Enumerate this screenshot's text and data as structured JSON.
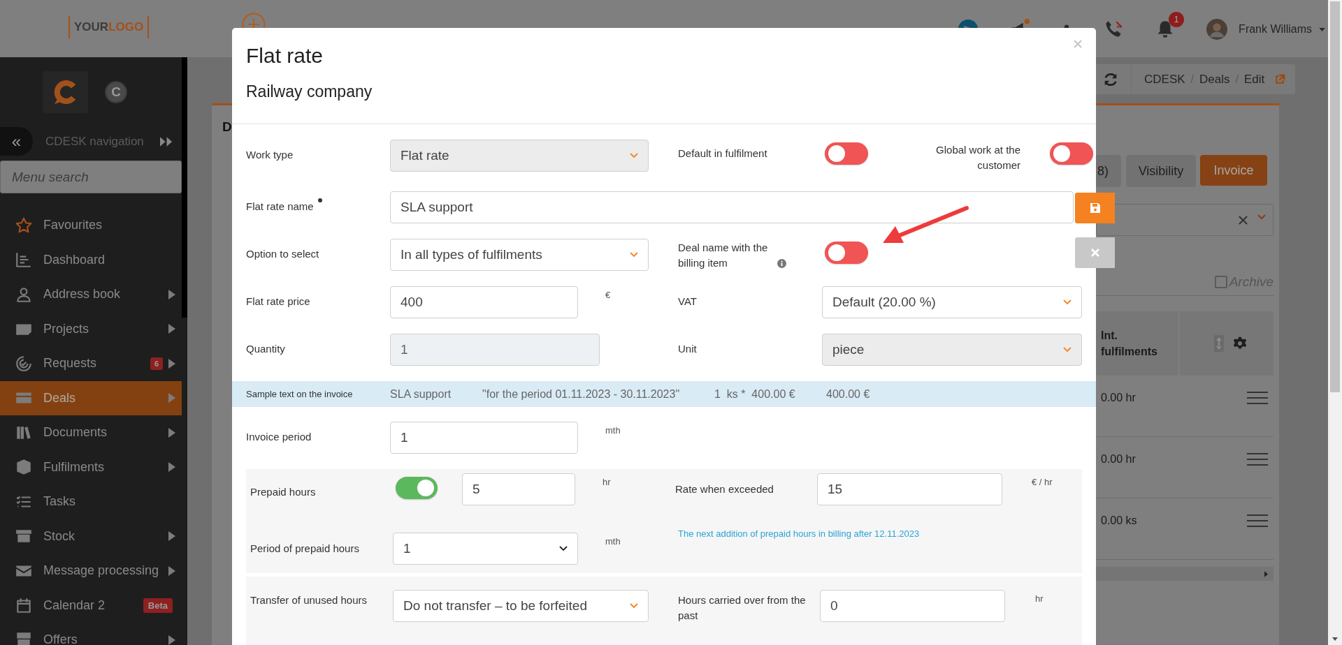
{
  "top_bar": {
    "logo": {
      "first": "YOUR",
      "second": "LOGO"
    },
    "notification_count": "1",
    "user_name": "Frank Williams"
  },
  "sidebar": {
    "initial": "C",
    "collapse": "«",
    "navigation_title": "CDESK navigation",
    "search": {
      "placeholder": "Menu search"
    },
    "items": [
      {
        "label": "Favourites",
        "submenu": false,
        "selected": false
      },
      {
        "label": "Dashboard",
        "submenu": false,
        "selected": false
      },
      {
        "label": "Address book",
        "submenu": true,
        "selected": false
      },
      {
        "label": "Projects",
        "submenu": true,
        "selected": false
      },
      {
        "label": "Requests",
        "submenu": true,
        "selected": false,
        "badge": "6"
      },
      {
        "label": "Deals",
        "submenu": true,
        "selected": true
      },
      {
        "label": "Documents",
        "submenu": true,
        "selected": false
      },
      {
        "label": "Fulfilments",
        "submenu": true,
        "selected": false
      },
      {
        "label": "Tasks",
        "submenu": false,
        "selected": false
      },
      {
        "label": "Stock",
        "submenu": true,
        "selected": false
      },
      {
        "label": "Message processing",
        "submenu": true,
        "selected": false
      },
      {
        "label": "Calendar 2",
        "submenu": false,
        "selected": false,
        "badge": "Beta"
      },
      {
        "label": "Offers",
        "submenu": true,
        "selected": false
      }
    ]
  },
  "breadcrumb": [
    {
      "label": "CDESK",
      "separator": "/"
    },
    {
      "label": "Deals",
      "separator": "/"
    },
    {
      "label": "Edit"
    }
  ],
  "page": {
    "heading": "D",
    "tabs": [
      {
        "label": "8)",
        "selected": false
      },
      {
        "label": "Visibility",
        "selected": false
      },
      {
        "label": "Invoice",
        "selected": true
      }
    ],
    "archive": {
      "label": "Archive",
      "checked": false
    },
    "table": {
      "column": "Int. fulfilments",
      "rows": [
        "0.00 hr",
        "0.00 hr",
        "0.00 ks"
      ]
    }
  },
  "dialog": {
    "title": "Flat rate",
    "subtitle": "Railway company",
    "work_type": {
      "label": "Work type",
      "value": "Flat rate",
      "disabled": true
    },
    "default_in_fulfilment": {
      "label": "Default in fulfilment",
      "on": false
    },
    "global_work": {
      "label": "Global work at the customer",
      "on": false
    },
    "flat_rate_name": {
      "label": "Flat rate name",
      "value": "SLA support",
      "required": true
    },
    "option_to_select": {
      "label": "Option to select",
      "value": "In all types of fulfilments"
    },
    "deal_name": {
      "label": "Deal name with the billing item",
      "on": false
    },
    "flat_rate_price": {
      "label": "Flat rate price",
      "value": "400",
      "unit": "€"
    },
    "vat": {
      "label": "VAT",
      "value": "Default (20.00 %)"
    },
    "quantity": {
      "label": "Quantity",
      "value": "1",
      "disabled": true
    },
    "unit": {
      "label": "Unit",
      "value": "piece",
      "disabled": true
    },
    "sample": {
      "label": "Sample text on the invoice",
      "parts": [
        "SLA support",
        "\"for the period 01.11.2023 - 30.11.2023\"",
        "1  ks *  400.00 €",
        "400.00 €"
      ]
    },
    "invoice_period": {
      "label": "Invoice period",
      "value": "1",
      "unit": "mth"
    },
    "prepaid_hours": {
      "label": "Prepaid hours",
      "on": true,
      "value": "5",
      "unit": "hr"
    },
    "rate_when_exceeded": {
      "label": "Rate when exceeded",
      "value": "15",
      "unit": "€ / hr"
    },
    "period_of_prepaid_hours": {
      "label": "Period of prepaid hours",
      "value": "1",
      "unit": "mth"
    },
    "next_addition_note": "The next addition of prepaid hours in billing after 12.11.2023",
    "transfer_unused_hours": {
      "label": "Transfer of unused hours",
      "value": "Do not transfer – to be forfeited"
    },
    "hours_carried_over": {
      "label": "Hours carried over from the past",
      "value": "0",
      "unit": "hr"
    }
  }
}
